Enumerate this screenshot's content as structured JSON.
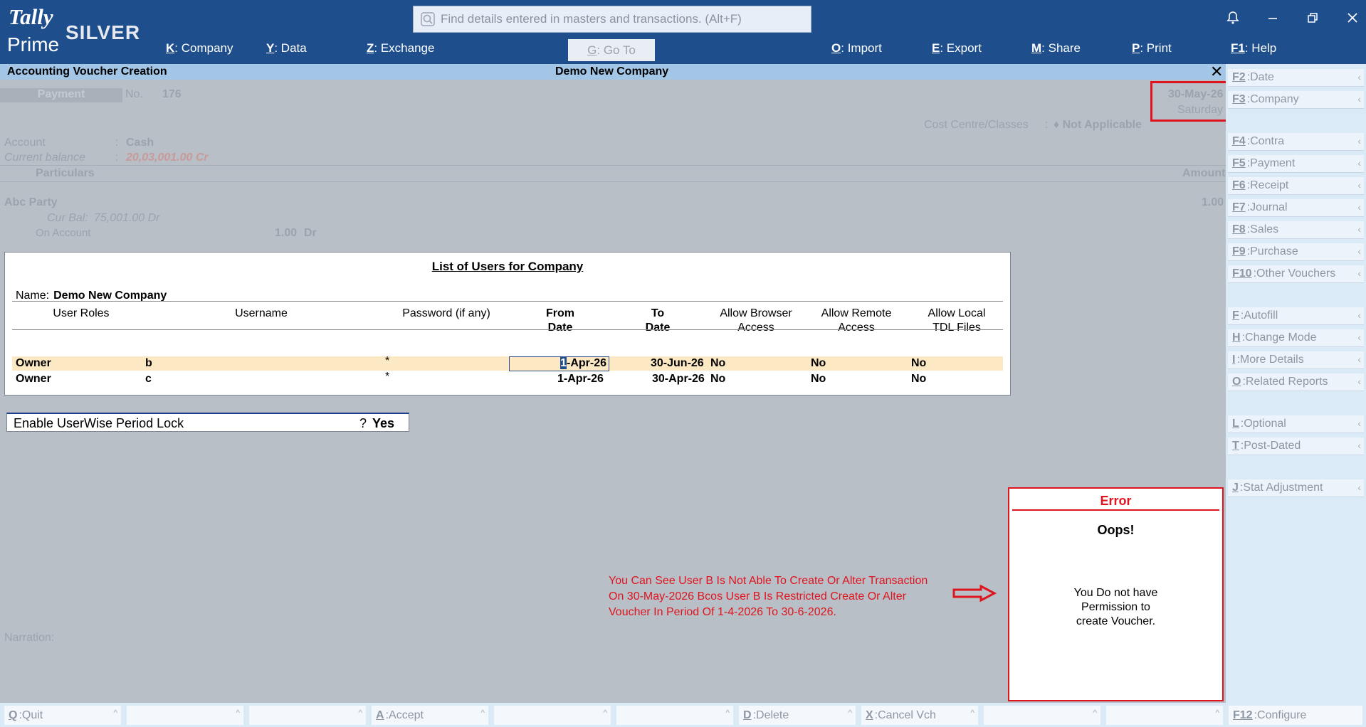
{
  "app": {
    "logo_tally": "Tally",
    "logo_prime": "Prime",
    "edition": "SILVER",
    "search_placeholder": "Find details entered in masters and transactions. (Alt+F)"
  },
  "menu": [
    {
      "key": "K",
      "label": "Company"
    },
    {
      "key": "Y",
      "label": "Data"
    },
    {
      "key": "Z",
      "label": "Exchange"
    },
    {
      "key": "G",
      "label": "Go To"
    },
    {
      "key": "O",
      "label": "Import"
    },
    {
      "key": "E",
      "label": "Export"
    },
    {
      "key": "M",
      "label": "Share"
    },
    {
      "key": "P",
      "label": "Print"
    },
    {
      "key": "F1",
      "label": "Help"
    }
  ],
  "titlebar": {
    "screen": "Accounting Voucher Creation",
    "company": "Demo New Company",
    "close": "✕"
  },
  "voucher": {
    "type": "Payment",
    "no_label": "No.",
    "number": "176",
    "date": "30-May-26",
    "day": "Saturday",
    "cost_centre_label": "Cost Centre/Classes",
    "cost_centre_sep": ":",
    "cost_centre_value": "♦ Not Applicable",
    "account_label": "Account",
    "account_sep": ":",
    "account_value": "Cash",
    "balance_label": "Current balance",
    "balance_sep": ":",
    "balance_value": "20,03,001.00 Cr",
    "particulars_header": "Particulars",
    "amount_header": "Amount",
    "ledger": "Abc Party",
    "ledger_amount": "1.00",
    "cur_bal_label": "Cur Bal:",
    "cur_bal_value": "75,001.00 Dr",
    "on_account_label": "On Account",
    "on_account_value": "1.00",
    "on_account_drcr": "Dr",
    "narration_label": "Narration:"
  },
  "users_panel": {
    "title": "List of Users for Company",
    "name_label": "Name:",
    "name_value": "Demo New Company",
    "headers": {
      "role": "User Roles",
      "username": "Username",
      "password": "Password (if any)",
      "from_1": "From",
      "from_2": "Date",
      "to_1": "To",
      "to_2": "Date",
      "browser_1": "Allow Browser",
      "browser_2": "Access",
      "remote_1": "Allow Remote",
      "remote_2": "Access",
      "tdl_1": "Allow Local",
      "tdl_2": "TDL Files"
    },
    "rows": [
      {
        "role": "Owner",
        "username": "b",
        "password": "*",
        "from_cursor": "1",
        "from_rest": "-Apr-26",
        "to": "30-Jun-26",
        "browser": "No",
        "remote": "No",
        "tdl": "No"
      },
      {
        "role": "Owner",
        "username": "c",
        "password": "*",
        "from": "1-Apr-26",
        "to": "30-Apr-26",
        "browser": "No",
        "remote": "No",
        "tdl": "No"
      }
    ]
  },
  "period_lock": {
    "label": "Enable UserWise Period Lock",
    "q": "?",
    "value": "Yes"
  },
  "annotation": {
    "line1": "You Can See User B Is Not Able To Create Or Alter Transaction",
    "line2": "On 30-May-2026 Bcos User B Is Restricted Create Or Alter",
    "line3": "Voucher In Period Of 1-4-2026 To 30-6-2026.",
    "color": "#e0141e"
  },
  "error": {
    "title": "Error",
    "headline": "Oops!",
    "line1": "You Do not have",
    "line2": "Permission to",
    "line3": "create Voucher."
  },
  "sidebar": [
    {
      "key": "F2",
      "label": "Date"
    },
    {
      "key": "F3",
      "label": "Company"
    },
    {
      "key": "F4",
      "label": "Contra"
    },
    {
      "key": "F5",
      "label": "Payment"
    },
    {
      "key": "F6",
      "label": "Receipt"
    },
    {
      "key": "F7",
      "label": "Journal"
    },
    {
      "key": "F8",
      "label": "Sales"
    },
    {
      "key": "F9",
      "label": "Purchase"
    },
    {
      "key": "F10",
      "label": "Other Vouchers"
    },
    {
      "key": "F",
      "label": "Autofill"
    },
    {
      "key": "H",
      "label": "Change Mode"
    },
    {
      "key": "I",
      "label": "More Details"
    },
    {
      "key": "O",
      "label": "Related Reports"
    },
    {
      "key": "L",
      "label": "Optional"
    },
    {
      "key": "T",
      "label": "Post-Dated"
    },
    {
      "key": "J",
      "label": "Stat Adjustment"
    },
    {
      "key": "F12",
      "label": "Configure"
    }
  ],
  "bottom": [
    {
      "key": "Q",
      "label": "Quit"
    },
    {
      "key": "A",
      "label": "Accept"
    },
    {
      "key": "D",
      "label": "Delete"
    },
    {
      "key": "X",
      "label": "Cancel Vch"
    }
  ],
  "colors": {
    "topbar": "#1f4e8c",
    "titlebar": "#a4c6e6",
    "background": "#b8bfc6",
    "highlight_row": "#fce9c3",
    "error": "#e0141e"
  }
}
